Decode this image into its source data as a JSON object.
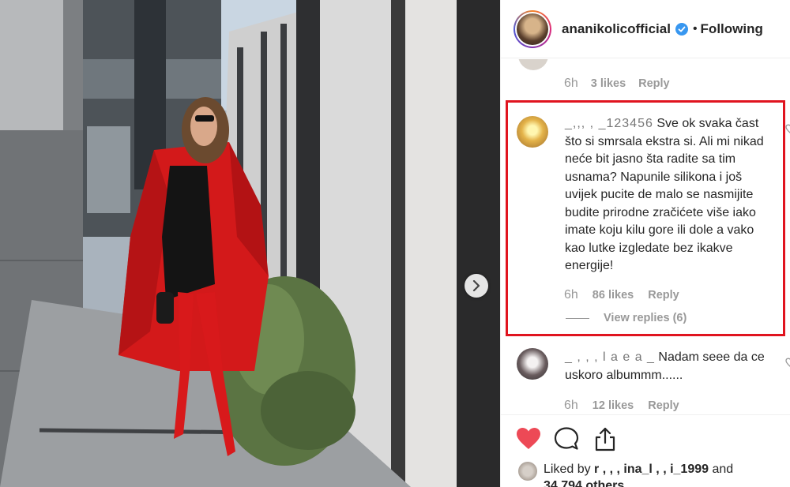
{
  "post": {
    "account": "ananikolicofficial",
    "verified": true,
    "separator": "•",
    "follow_status": "Following"
  },
  "previous_comment": {
    "time": "6h",
    "likes": "3 likes",
    "reply": "Reply"
  },
  "comments": [
    {
      "username": "_,,, , _123456",
      "text": "Sve ok svaka čast što si smrsala ekstra si. Ali mi nikad neće bit jasno šta radite sa tim usnama? Napunile silikona i još uvijek pucite de malo se nasmijite budite prirodne zračićete više iako imate koju kilu gore ili dole a vako kao lutke izgledate bez ikakve energije!",
      "time": "6h",
      "likes": "86 likes",
      "reply": "Reply",
      "view_replies": "View replies (6)"
    },
    {
      "username": "_ , , , l a e a _",
      "text": "Nadam seee da ce uskoro albummm......",
      "time": "6h",
      "likes": "12 likes",
      "reply": "Reply"
    }
  ],
  "footer": {
    "liked_by_prefix": "Liked by",
    "liked_by_user": "r , , , ina_l , , i_1999",
    "and": "and",
    "others_count": "34,794 others"
  },
  "icons": {
    "heart": "heart-filled-icon",
    "comment": "comment-bubble-icon",
    "share": "share-upload-icon",
    "next": "chevron-right-icon",
    "verified": "verified-badge-icon"
  },
  "colors": {
    "heart": "#ed4956",
    "verified": "#3897f0",
    "highlight_box": "#e0141f",
    "muted_text": "#999999"
  }
}
